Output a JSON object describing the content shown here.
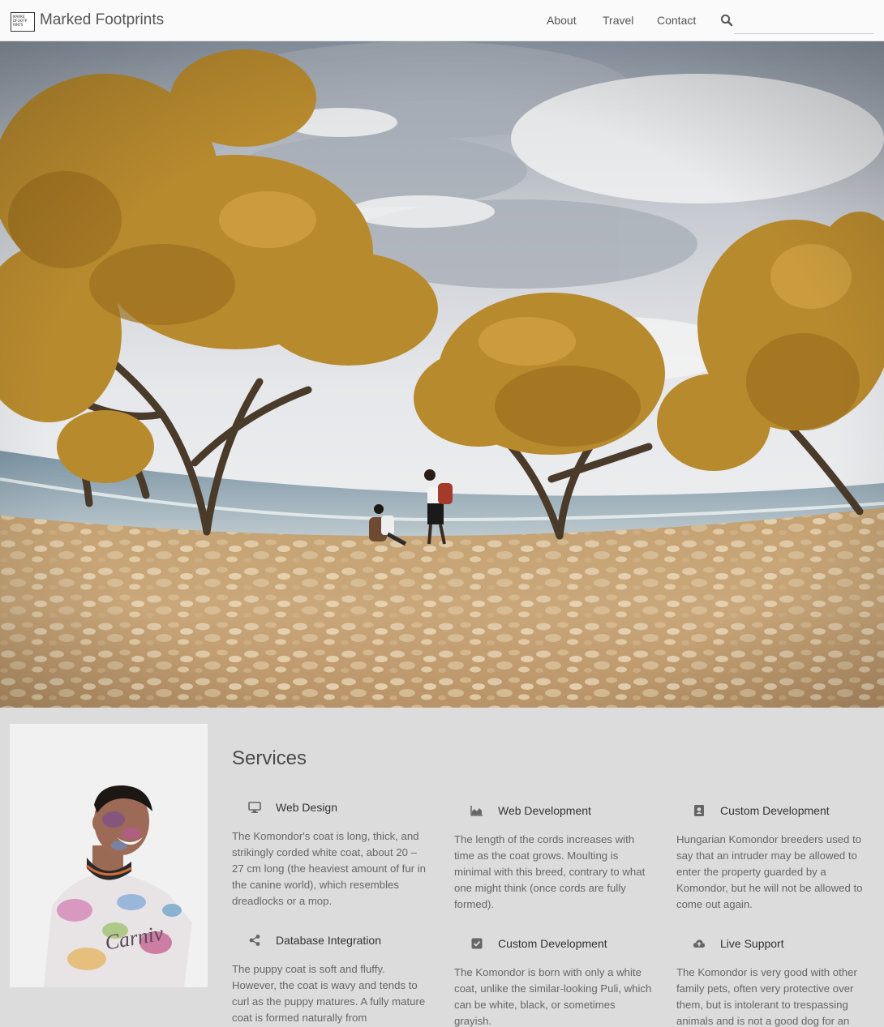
{
  "header": {
    "logo_lines": [
      "MARKE",
      "DFOOTP",
      "RINTS"
    ],
    "brand": "Marked Footprints",
    "nav": [
      "About",
      "Travel",
      "Contact"
    ],
    "search_placeholder": ""
  },
  "services": {
    "title": "Services",
    "items": [
      {
        "icon": "monitor-icon",
        "title": "Web Design",
        "description": "The Komondor's coat is long, thick, and strikingly corded white coat, about 20 – 27 cm long (the heaviest amount of fur in the canine world), which resembles dreadlocks or a mop."
      },
      {
        "icon": "area-chart-icon",
        "title": "Web Development",
        "description": "The length of the cords increases with time as the coat grows. Moulting is minimal with this breed, contrary to what one might think (once cords are fully formed)."
      },
      {
        "icon": "contacts-icon",
        "title": "Custom Development",
        "description": "Hungarian Komondor breeders used to say that an intruder may be allowed to enter the property guarded by a Komondor, but he will not be allowed to come out again."
      },
      {
        "icon": "share-icon",
        "title": "Database Integration",
        "description": "The puppy coat is soft and fluffy. However, the coat is wavy and tends to curl as the puppy matures. A fully mature coat is formed naturally from"
      },
      {
        "icon": "checkbox-icon",
        "title": "Custom Development",
        "description": "The Komondor is born with only a white coat, unlike the similar-looking Puli, which can be white, black, or sometimes grayish."
      },
      {
        "icon": "cloud-upload-icon",
        "title": "Live Support",
        "description": "The Komondor is very good with other family pets, often very protective over them, but is intolerant to trespassing animals and is not a good dog for an"
      }
    ]
  },
  "colors": {
    "header_bg": "#fafafa",
    "page_bg": "#dcdcdc",
    "tree_foliage": "#b88a2e",
    "beach_sand": "#c9a676"
  }
}
